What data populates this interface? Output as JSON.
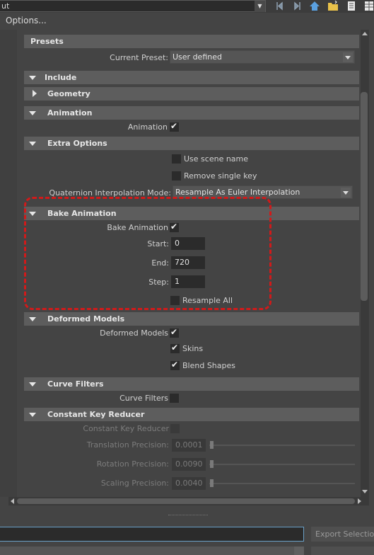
{
  "toolbar": {
    "combo_text": "ut",
    "icons": [
      "nav-back-icon",
      "nav-forward-icon",
      "home-icon",
      "folder-icon",
      "list-icon",
      "grid-icon"
    ]
  },
  "menu": {
    "options": "Options..."
  },
  "presets": {
    "title": "Presets",
    "current_preset_label": "Current Preset:",
    "current_preset_value": "User defined"
  },
  "include": {
    "title": "Include"
  },
  "geometry": {
    "title": "Geometry"
  },
  "animation": {
    "title": "Animation",
    "animation_label": "Animation",
    "animation_checked": true
  },
  "extra_options": {
    "title": "Extra Options",
    "use_scene_name": "Use scene name",
    "remove_single_key": "Remove single key",
    "quaternion_label": "Quaternion Interpolation Mode:",
    "quaternion_value": "Resample As Euler Interpolation"
  },
  "bake_animation": {
    "title": "Bake Animation",
    "bake_label": "Bake Animation",
    "start_label": "Start:",
    "start_value": "0",
    "end_label": "End:",
    "end_value": "720",
    "step_label": "Step:",
    "step_value": "1",
    "resample_all": "Resample All"
  },
  "deformed_models": {
    "title": "Deformed Models",
    "deformed_label": "Deformed Models",
    "skins": "Skins",
    "blend_shapes": "Blend Shapes"
  },
  "curve_filters": {
    "title": "Curve Filters",
    "curve_filters_label": "Curve Filters"
  },
  "constant_key_reducer": {
    "title": "Constant Key Reducer",
    "reducer_label": "Constant Key Reducer",
    "translation_label": "Translation Precision:",
    "translation_value": "0.0001",
    "rotation_label": "Rotation Precision:",
    "rotation_value": "0.0090",
    "scaling_label": "Scaling Precision:",
    "scaling_value": "0.0040"
  },
  "bottom": {
    "export_button": "Export Selection"
  },
  "colors": {
    "background": "#444444",
    "section_header": "#5d5d5d",
    "field": "#2b2b2b",
    "annotation": "#d11a1a",
    "focus": "#6aa0c8"
  }
}
